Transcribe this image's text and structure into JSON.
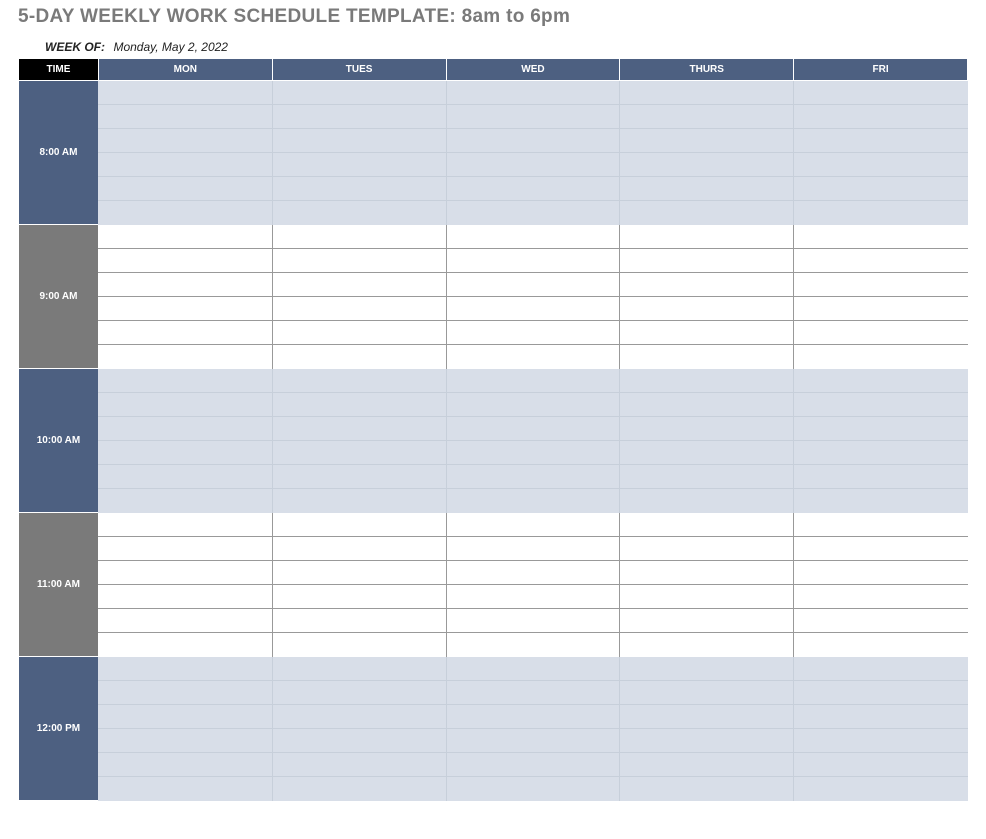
{
  "title": "5-DAY WEEKLY WORK SCHEDULE TEMPLATE: 8am to 6pm",
  "week_of_label": "WEEK OF:",
  "week_of_value": "Monday, May 2, 2022",
  "header": {
    "time": "TIME",
    "days": [
      "MON",
      "TUES",
      "WED",
      "THURS",
      "FRI"
    ]
  },
  "hours": [
    {
      "label": "8:00 AM",
      "style": "blue",
      "shaded": true,
      "slots": [
        [
          "",
          "",
          "",
          "",
          ""
        ],
        [
          "",
          "",
          "",
          "",
          ""
        ],
        [
          "",
          "",
          "",
          "",
          ""
        ],
        [
          "",
          "",
          "",
          "",
          ""
        ],
        [
          "",
          "",
          "",
          "",
          ""
        ],
        [
          "",
          "",
          "",
          "",
          ""
        ]
      ]
    },
    {
      "label": "9:00 AM",
      "style": "gray",
      "shaded": false,
      "slots": [
        [
          "",
          "",
          "",
          "",
          ""
        ],
        [
          "",
          "",
          "",
          "",
          ""
        ],
        [
          "",
          "",
          "",
          "",
          ""
        ],
        [
          "",
          "",
          "",
          "",
          ""
        ],
        [
          "",
          "",
          "",
          "",
          ""
        ],
        [
          "",
          "",
          "",
          "",
          ""
        ]
      ]
    },
    {
      "label": "10:00 AM",
      "style": "blue",
      "shaded": true,
      "slots": [
        [
          "",
          "",
          "",
          "",
          ""
        ],
        [
          "",
          "",
          "",
          "",
          ""
        ],
        [
          "",
          "",
          "",
          "",
          ""
        ],
        [
          "",
          "",
          "",
          "",
          ""
        ],
        [
          "",
          "",
          "",
          "",
          ""
        ],
        [
          "",
          "",
          "",
          "",
          ""
        ]
      ]
    },
    {
      "label": "11:00 AM",
      "style": "gray",
      "shaded": false,
      "slots": [
        [
          "",
          "",
          "",
          "",
          ""
        ],
        [
          "",
          "",
          "",
          "",
          ""
        ],
        [
          "",
          "",
          "",
          "",
          ""
        ],
        [
          "",
          "",
          "",
          "",
          ""
        ],
        [
          "",
          "",
          "",
          "",
          ""
        ],
        [
          "",
          "",
          "",
          "",
          ""
        ]
      ]
    },
    {
      "label": "12:00 PM",
      "style": "blue",
      "shaded": true,
      "slots": [
        [
          "",
          "",
          "",
          "",
          ""
        ],
        [
          "",
          "",
          "",
          "",
          ""
        ],
        [
          "",
          "",
          "",
          "",
          ""
        ],
        [
          "",
          "",
          "",
          "",
          ""
        ],
        [
          "",
          "",
          "",
          "",
          ""
        ],
        [
          "",
          "",
          "",
          "",
          ""
        ]
      ]
    }
  ]
}
